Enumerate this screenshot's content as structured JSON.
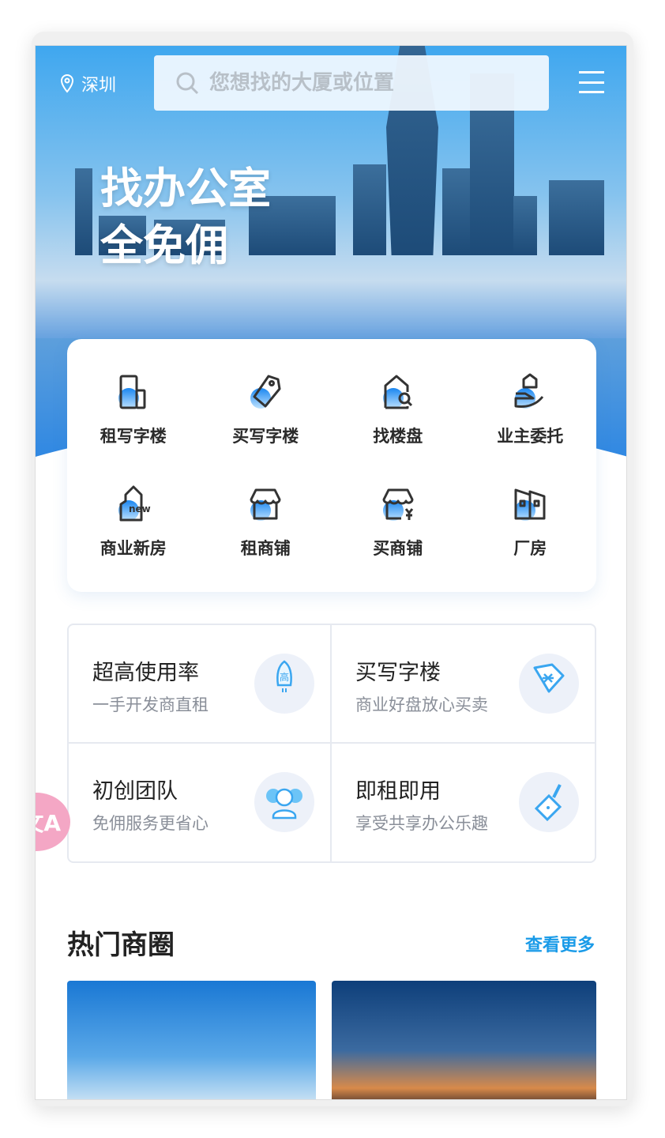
{
  "header": {
    "city": "深圳",
    "search_placeholder": "您想找的大厦或位置"
  },
  "hero": {
    "slogan_line1": "找办公室",
    "slogan_line2": "全免佣"
  },
  "categories": [
    {
      "label": "租写字楼",
      "icon": "office-building-icon"
    },
    {
      "label": "买写字楼",
      "icon": "price-tag-icon"
    },
    {
      "label": "找楼盘",
      "icon": "house-search-icon"
    },
    {
      "label": "业主委托",
      "icon": "hand-house-icon"
    },
    {
      "label": "商业新房",
      "icon": "new-house-icon"
    },
    {
      "label": "租商铺",
      "icon": "shop-icon"
    },
    {
      "label": "买商铺",
      "icon": "shop-yuan-icon"
    },
    {
      "label": "厂房",
      "icon": "factory-icon"
    }
  ],
  "features": [
    {
      "title": "超高使用率",
      "subtitle": "一手开发商直租",
      "icon": "rocket-icon",
      "icon_text": "高"
    },
    {
      "title": "买写字楼",
      "subtitle": "商业好盘放心买卖",
      "icon": "yuan-tag-icon"
    },
    {
      "title": "初创团队",
      "subtitle": "免佣服务更省心",
      "icon": "team-icon"
    },
    {
      "title": "即租即用",
      "subtitle": "享受共享办公乐趣",
      "icon": "briefcase-icon"
    }
  ],
  "translate_fab": {
    "icon": "translate-icon",
    "text": "文A"
  },
  "hot_areas": {
    "title": "热门商圈",
    "more_label": "查看更多"
  },
  "colors": {
    "accent": "#1a9be8",
    "icon_blue": "#3aa6f0",
    "text": "#222222"
  }
}
